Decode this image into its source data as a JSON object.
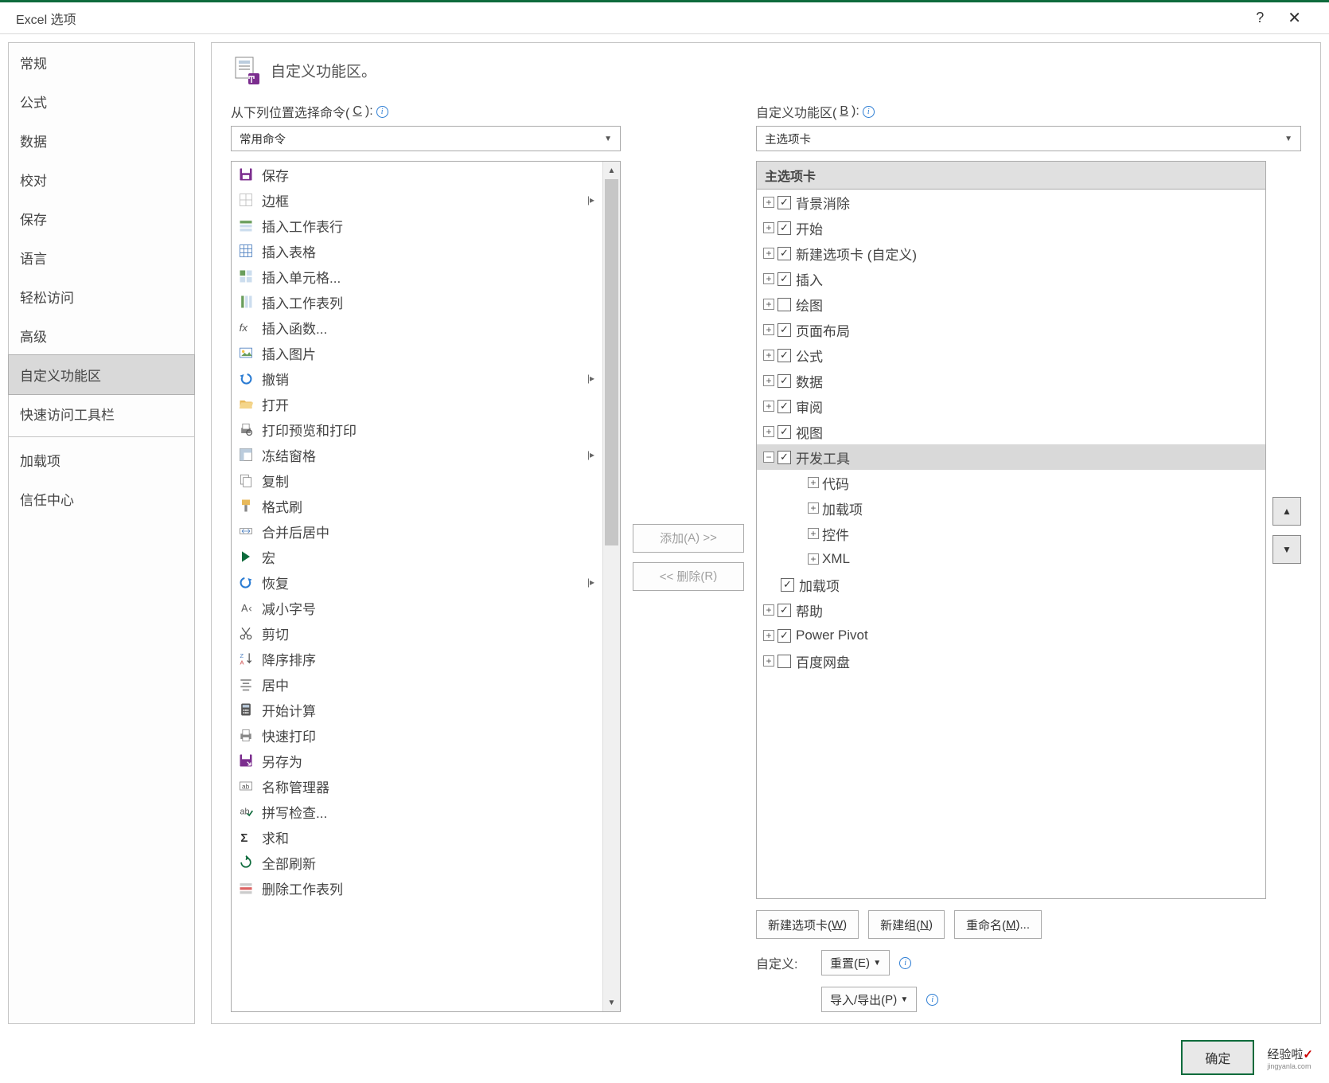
{
  "window": {
    "title": "Excel 选项"
  },
  "sidebar": {
    "items": [
      "常规",
      "公式",
      "数据",
      "校对",
      "保存",
      "语言",
      "轻松访问",
      "高级",
      "自定义功能区",
      "快速访问工具栏",
      "加载项",
      "信任中心"
    ],
    "selected_index": 8
  },
  "header": {
    "title": "自定义功能区。"
  },
  "left": {
    "label_pre": "从下列位置选择命令(",
    "label_accel": "C",
    "label_post": "):",
    "dropdown": "常用命令",
    "commands": [
      {
        "icon": "save",
        "label": "保存"
      },
      {
        "icon": "border",
        "label": "边框",
        "sub": "▸"
      },
      {
        "icon": "insert-rows",
        "label": "插入工作表行"
      },
      {
        "icon": "insert-table",
        "label": "插入表格"
      },
      {
        "icon": "insert-cells",
        "label": "插入单元格..."
      },
      {
        "icon": "insert-cols",
        "label": "插入工作表列"
      },
      {
        "icon": "fx",
        "label": "插入函数..."
      },
      {
        "icon": "insert-pic",
        "label": "插入图片"
      },
      {
        "icon": "undo",
        "label": "撤销",
        "sub": "▸"
      },
      {
        "icon": "open",
        "label": "打开"
      },
      {
        "icon": "print-preview",
        "label": "打印预览和打印"
      },
      {
        "icon": "freeze",
        "label": "冻结窗格",
        "sub": "▸"
      },
      {
        "icon": "copy",
        "label": "复制"
      },
      {
        "icon": "format-painter",
        "label": "格式刷"
      },
      {
        "icon": "merge",
        "label": "合并后居中"
      },
      {
        "icon": "macro",
        "label": "宏"
      },
      {
        "icon": "redo",
        "label": "恢复",
        "sub": "▸"
      },
      {
        "icon": "font-dec",
        "label": "减小字号"
      },
      {
        "icon": "cut",
        "label": "剪切"
      },
      {
        "icon": "sort-desc",
        "label": "降序排序"
      },
      {
        "icon": "center",
        "label": "居中"
      },
      {
        "icon": "calc",
        "label": "开始计算"
      },
      {
        "icon": "quickprint",
        "label": "快速打印"
      },
      {
        "icon": "saveas",
        "label": "另存为"
      },
      {
        "icon": "name-mgr",
        "label": "名称管理器"
      },
      {
        "icon": "spell",
        "label": "拼写检查..."
      },
      {
        "icon": "sum",
        "label": "求和"
      },
      {
        "icon": "refresh-all",
        "label": "全部刷新"
      },
      {
        "icon": "delete-rows",
        "label": "删除工作表列"
      }
    ]
  },
  "mid": {
    "add_pre": "添加(",
    "add_accel": "A",
    "add_post": ") >>",
    "remove_pre": "<< 删除(",
    "remove_accel": "R",
    "remove_post": ")"
  },
  "right": {
    "label_pre": "自定义功能区(",
    "label_accel": "B",
    "label_post": "):",
    "dropdown": "主选项卡",
    "tree_header": "主选项卡",
    "tabs": [
      {
        "exp": "+",
        "chk": true,
        "label": "背景消除",
        "indent": 0
      },
      {
        "exp": "+",
        "chk": true,
        "label": "开始",
        "indent": 0
      },
      {
        "exp": "+",
        "chk": true,
        "label": "新建选项卡 (自定义)",
        "indent": 0
      },
      {
        "exp": "+",
        "chk": true,
        "label": "插入",
        "indent": 0
      },
      {
        "exp": "+",
        "chk": false,
        "label": "绘图",
        "indent": 0
      },
      {
        "exp": "+",
        "chk": true,
        "label": "页面布局",
        "indent": 0
      },
      {
        "exp": "+",
        "chk": true,
        "label": "公式",
        "indent": 0
      },
      {
        "exp": "+",
        "chk": true,
        "label": "数据",
        "indent": 0
      },
      {
        "exp": "+",
        "chk": true,
        "label": "审阅",
        "indent": 0
      },
      {
        "exp": "+",
        "chk": true,
        "label": "视图",
        "indent": 0
      },
      {
        "exp": "−",
        "chk": true,
        "label": "开发工具",
        "indent": 0,
        "selected": true
      },
      {
        "exp": "+",
        "chk": null,
        "label": "代码",
        "indent": 2
      },
      {
        "exp": "+",
        "chk": null,
        "label": "加载项",
        "indent": 2
      },
      {
        "exp": "+",
        "chk": null,
        "label": "控件",
        "indent": 2
      },
      {
        "exp": "+",
        "chk": null,
        "label": "XML",
        "indent": 2
      },
      {
        "exp": null,
        "chk": true,
        "label": "加载项",
        "indent": "0b"
      },
      {
        "exp": "+",
        "chk": true,
        "label": "帮助",
        "indent": 0
      },
      {
        "exp": "+",
        "chk": true,
        "label": "Power Pivot",
        "indent": 0
      },
      {
        "exp": "+",
        "chk": false,
        "label": "百度网盘",
        "indent": 0
      }
    ],
    "buttons": {
      "newtab_pre": "新建选项卡(",
      "newtab_accel": "W",
      "newtab_post": ")",
      "newgroup_pre": "新建组(",
      "newgroup_accel": "N",
      "newgroup_post": ")",
      "rename_pre": "重命名(",
      "rename_accel": "M",
      "rename_post": ")..."
    },
    "custom_label": "自定义:",
    "reset_pre": "重置(",
    "reset_accel": "E",
    "reset_post": ")",
    "impexp_pre": "导入/导出(",
    "impexp_accel": "P",
    "impexp_post": ")"
  },
  "footer": {
    "ok": "确定",
    "watermark": "经验啦",
    "watermark_sub": "jingyanla.com"
  }
}
